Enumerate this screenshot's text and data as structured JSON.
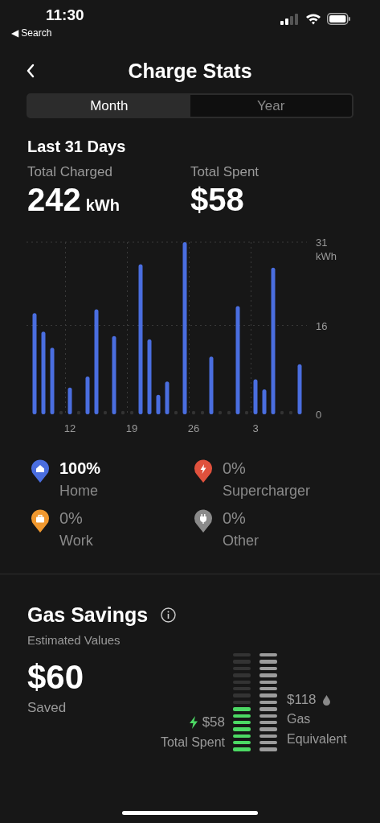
{
  "status_bar": {
    "time": "11:30",
    "back_link": "◀ Search"
  },
  "header": {
    "title": "Charge Stats"
  },
  "tabs": [
    {
      "label": "Month",
      "selected": true
    },
    {
      "label": "Year",
      "selected": false
    }
  ],
  "period": "Last 31 Days",
  "totals": [
    {
      "label": "Total Charged",
      "value": "242",
      "unit": "kWh"
    },
    {
      "label": "Total Spent",
      "value": "$58"
    }
  ],
  "chart": {
    "chart_data": {
      "type": "bar",
      "ylabel": "kWh",
      "grid": true,
      "categories": [
        null,
        null,
        null,
        null,
        "12",
        null,
        null,
        null,
        null,
        null,
        null,
        "19",
        null,
        null,
        null,
        null,
        null,
        null,
        "26",
        null,
        null,
        null,
        null,
        null,
        null,
        "3",
        null,
        null,
        null,
        null,
        null
      ],
      "values": [
        18.2,
        14.9,
        12,
        0,
        4.8,
        0,
        6.8,
        18.9,
        0,
        14.1,
        0,
        0,
        27,
        13.5,
        3.5,
        5.9,
        0,
        31,
        0,
        0,
        10.4,
        0,
        0,
        19.5,
        0,
        6.3,
        4.5,
        26.4,
        0,
        0,
        9
      ],
      "ylim": [
        0,
        31
      ],
      "yticks": [
        0,
        16,
        31
      ]
    }
  },
  "locations": [
    {
      "kind": "home",
      "color": "#4a6ee0",
      "percent": "100%",
      "label": "Home",
      "highlighted": true
    },
    {
      "kind": "bolt",
      "color": "#e0513d",
      "percent": "0%",
      "label": "Supercharger",
      "highlighted": false
    },
    {
      "kind": "work",
      "color": "#f0982f",
      "percent": "0%",
      "label": "Work",
      "highlighted": false
    },
    {
      "kind": "plug",
      "color": "#8a8a8a",
      "percent": "0%",
      "label": "Other",
      "highlighted": false
    }
  ],
  "gas_savings": {
    "title": "Gas Savings",
    "subtitle": "Estimated Values",
    "saved_value": "$60",
    "saved_label": "Saved",
    "spent_value": "$58",
    "spent_label": "Total Spent",
    "gas_value": "$118",
    "gas_label": "Gas Equivalent",
    "meters": [
      {
        "kind": "spent",
        "color": "#4cd964"
      },
      {
        "kind": "gas",
        "color": "#9c9c9c"
      }
    ]
  }
}
